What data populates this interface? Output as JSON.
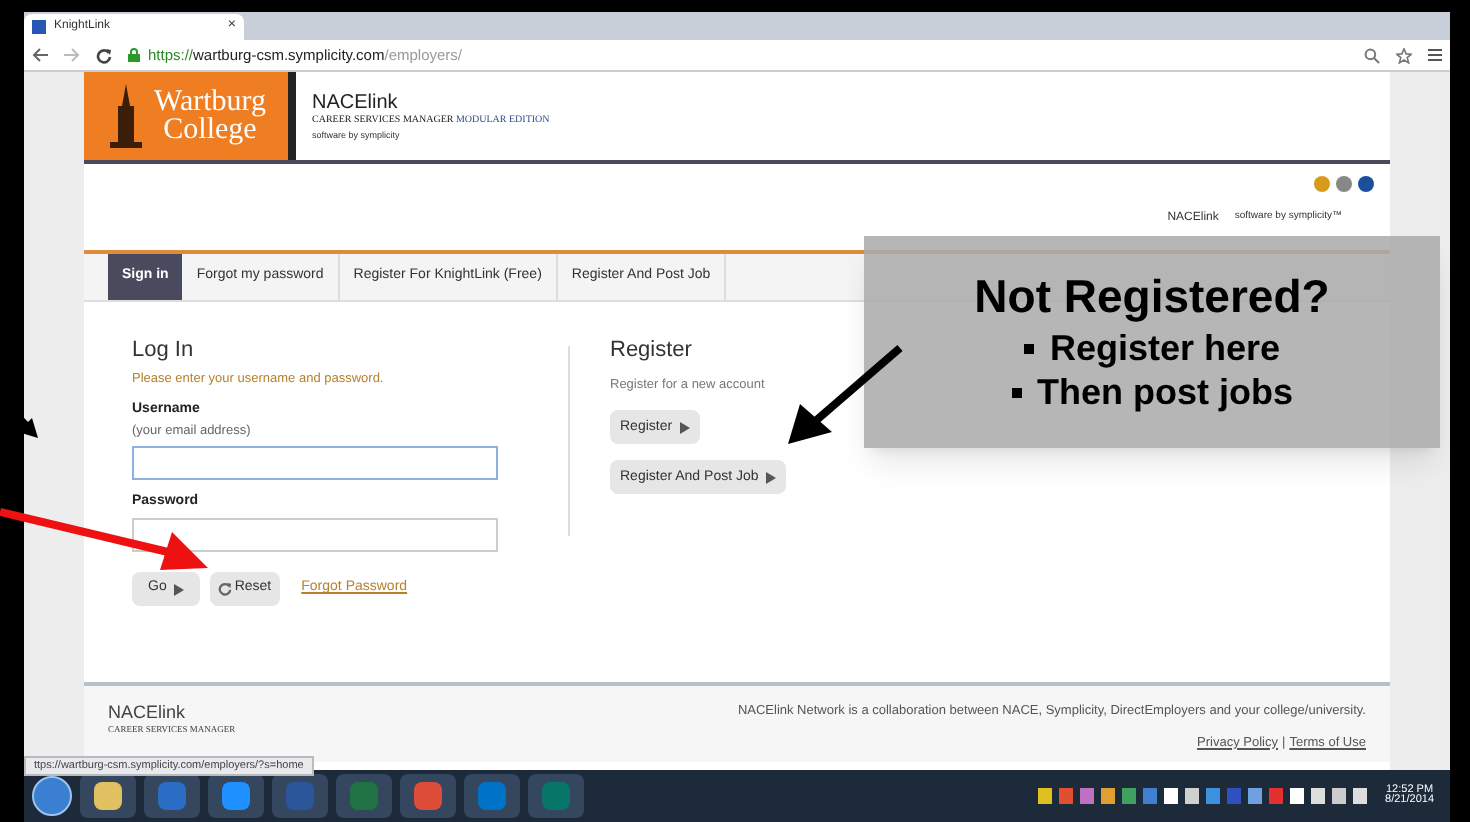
{
  "browser": {
    "tab_title": "KnightLink",
    "tab_close": "×",
    "url_secure": "https://",
    "url_host": "wartburg-csm.symplicity.com",
    "url_path": "/employers/"
  },
  "header": {
    "logo_line1": "Wartburg",
    "logo_line2": "College",
    "brand": "NACElink",
    "product": "CAREER SERVICES MANAGER",
    "edition": "MODULAR EDITION",
    "vendor": "software by symplicity"
  },
  "top_right": {
    "brand": "NACElink",
    "vendor": "software by symplicity™"
  },
  "tabs": [
    {
      "label": "Sign in",
      "selected": true
    },
    {
      "label": "Forgot my password",
      "selected": false
    },
    {
      "label": "Register For KnightLink (Free)",
      "selected": false
    },
    {
      "label": "Register And Post Job",
      "selected": false
    }
  ],
  "login": {
    "title": "Log In",
    "instructions": "Please enter your username and password.",
    "username_label": "Username",
    "username_hint": "(your email address)",
    "password_label": "Password",
    "go_button": "Go",
    "reset_button": "Reset",
    "forgot_link": "Forgot Password"
  },
  "register": {
    "title": "Register",
    "text": "Register for a new account",
    "buttons": [
      "Register",
      "Register And Post Job"
    ]
  },
  "footer": {
    "brand": "NACElink",
    "product": "CAREER SERVICES MANAGER",
    "note": "NACElink Network is a collaboration between NACE, Symplicity, DirectEmployers and your college/university.",
    "links": [
      "Privacy Policy",
      "Terms of Use"
    ],
    "separator": "|"
  },
  "status_url": "ttps://wartburg-csm.symplicity.com/employers/?s=home",
  "callout": {
    "title": "Not Registered?",
    "bullets": [
      "Register here",
      "Then post jobs"
    ]
  },
  "taskbar": {
    "time": "12:52 PM",
    "date": "8/21/2014"
  }
}
